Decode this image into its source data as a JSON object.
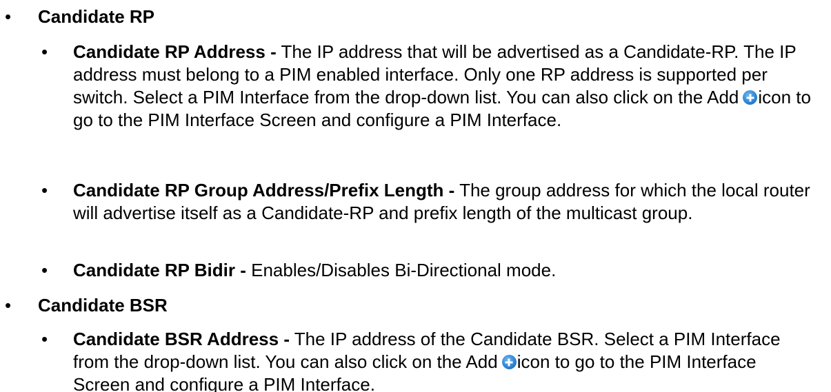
{
  "sections": [
    {
      "heading": "Candidate RP",
      "items": [
        {
          "term": "Candidate RP Address -",
          "desc_before_icon": " The IP address that will be advertised as a Candidate-RP. The IP address must belong to a PIM enabled interface. Only one RP address is supported per switch. Select a PIM Interface from the drop-down list. You can also click on the Add",
          "icon": "add-circle-icon",
          "desc_after_icon": "icon to go to the PIM Interface Screen and configure a PIM Interface."
        },
        {
          "term": "Candidate RP Group Address/Prefix Length -",
          "desc": " The group address for which the local router will advertise itself as a Candidate-RP and prefix length of the multicast group."
        },
        {
          "term": "Candidate RP Bidir -",
          "desc": " Enables/Disables Bi-Directional mode."
        }
      ]
    },
    {
      "heading": "Candidate BSR",
      "items": [
        {
          "term": "Candidate BSR Address -",
          "desc_before_icon": " The IP address of the Candidate BSR. Select a PIM Interface from the drop-down list. You can also click on the Add",
          "icon": "add-circle-icon",
          "desc_after_icon": "icon to go to the PIM Interface Screen and configure a PIM Interface."
        }
      ]
    }
  ],
  "bullet_glyph": "•",
  "colors": {
    "text": "#000000",
    "icon": "#2f86d4"
  }
}
